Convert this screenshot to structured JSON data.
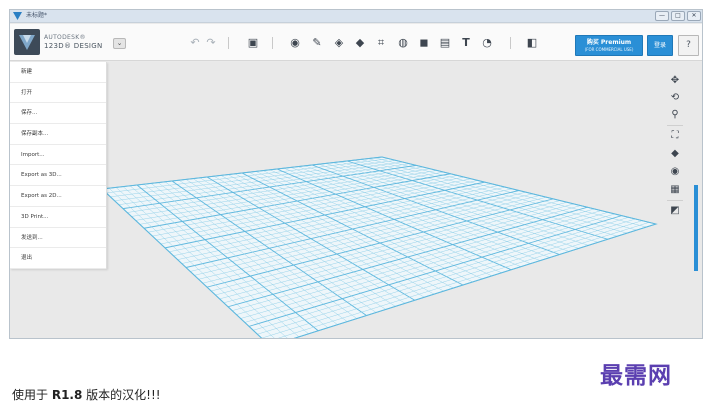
{
  "window": {
    "title": "未标题*",
    "controls": [
      "—",
      "□",
      "✕"
    ]
  },
  "toolbar": {
    "brand_line1": "AUTODESK®",
    "brand_line2": "123D® DESIGN",
    "dropdown_glyph": "⌄",
    "undo_glyph": "↶",
    "redo_glyph": "↷",
    "tools": [
      {
        "name": "transform-icon",
        "glyph": "▣"
      },
      {
        "name": "primitives-icon",
        "glyph": "◉"
      },
      {
        "name": "sketch-icon",
        "glyph": "✎"
      },
      {
        "name": "construct-icon",
        "glyph": "◈"
      },
      {
        "name": "modify-icon",
        "glyph": "◆"
      },
      {
        "name": "pattern-icon",
        "glyph": "⌗"
      },
      {
        "name": "grouping-icon",
        "glyph": "◍"
      },
      {
        "name": "combine-icon",
        "glyph": "◼"
      },
      {
        "name": "measure-icon",
        "glyph": "▤"
      },
      {
        "name": "text-icon",
        "glyph": "T"
      },
      {
        "name": "snap-icon",
        "glyph": "◔"
      },
      {
        "name": "material-icon",
        "glyph": "◧"
      }
    ],
    "premium_label": "购买 Premium",
    "premium_sublabel": "(FOR COMMERCIAL USE)",
    "login_label": "登录",
    "help_label": "?"
  },
  "menu": {
    "items": [
      "新建",
      "打开",
      "保存...",
      "保存副本...",
      "Import...",
      "Export as 3D...",
      "Export as 2D...",
      "3D Print...",
      "发送到...",
      "退出"
    ]
  },
  "navbar": {
    "icons": [
      {
        "name": "pan-icon",
        "glyph": "✥"
      },
      {
        "name": "orbit-icon",
        "glyph": "⟲"
      },
      {
        "name": "zoom-icon",
        "glyph": "⚲"
      },
      {
        "name": "fit-icon",
        "glyph": "⛶"
      },
      {
        "name": "view-mode-icon",
        "glyph": "◆"
      },
      {
        "name": "visibility-icon",
        "glyph": "◉"
      },
      {
        "name": "grid-toggle-icon",
        "glyph": "▦"
      },
      {
        "name": "material-view-icon",
        "glyph": "◩"
      }
    ]
  },
  "caption": {
    "prefix": "使用于 ",
    "version": "R1.8",
    "suffix": " 版本的汉化!!!"
  },
  "watermark": "最需网",
  "colors": {
    "accent_blue": "#2a8fd6",
    "grid_line": "#8fcfe8",
    "grid_edge": "#5fb8de",
    "watermark": "#5b3fb0"
  }
}
